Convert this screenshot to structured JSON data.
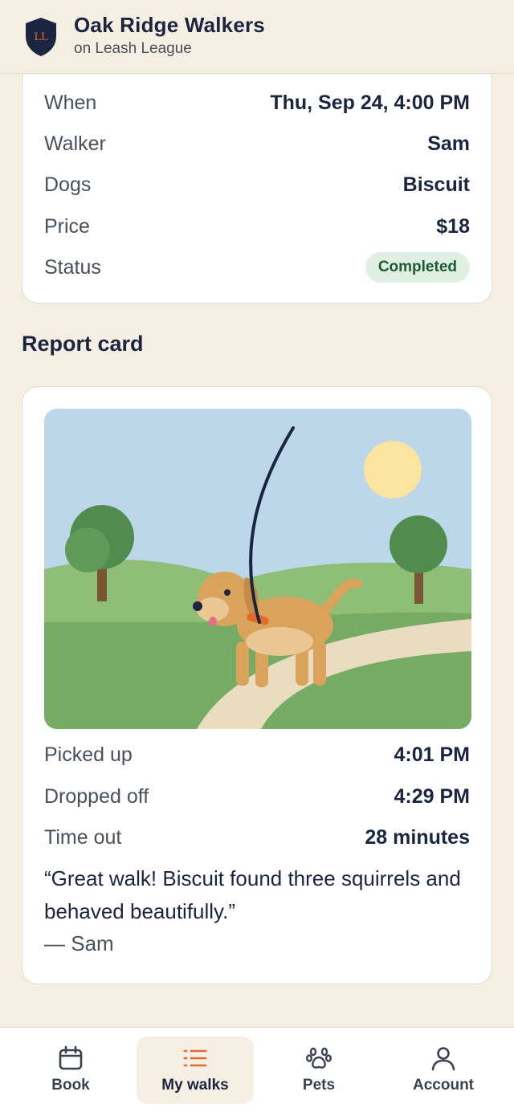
{
  "header": {
    "org_name": "Oak Ridge Walkers",
    "org_subtitle": "on Leash League",
    "logo_text": "LL"
  },
  "details": {
    "rows": [
      {
        "label": "When",
        "value": "Thu, Sep 24, 4:00 PM"
      },
      {
        "label": "Walker",
        "value": "Sam"
      },
      {
        "label": "Dogs",
        "value": "Biscuit"
      },
      {
        "label": "Price",
        "value": "$18"
      },
      {
        "label": "Status",
        "value": "Completed"
      }
    ]
  },
  "report": {
    "title": "Report card",
    "rows": [
      {
        "label": "Picked up",
        "value": "4:01 PM"
      },
      {
        "label": "Dropped off",
        "value": "4:29 PM"
      },
      {
        "label": "Time out",
        "value": "28 minutes"
      }
    ],
    "quote": "“Great walk! Biscuit found three squirrels and behaved beautifully.”",
    "author": "— Sam"
  },
  "nav": {
    "items": [
      {
        "label": "Book",
        "icon": "calendar-icon"
      },
      {
        "label": "My walks",
        "icon": "list-icon"
      },
      {
        "label": "Pets",
        "icon": "paw-icon"
      },
      {
        "label": "Account",
        "icon": "user-icon"
      }
    ],
    "active": "My walks"
  },
  "colors": {
    "background": "#f5efe3",
    "navy": "#1c2540",
    "accent": "#e2692a",
    "status_bg": "#dff0e2",
    "status_text": "#1f5a32"
  }
}
